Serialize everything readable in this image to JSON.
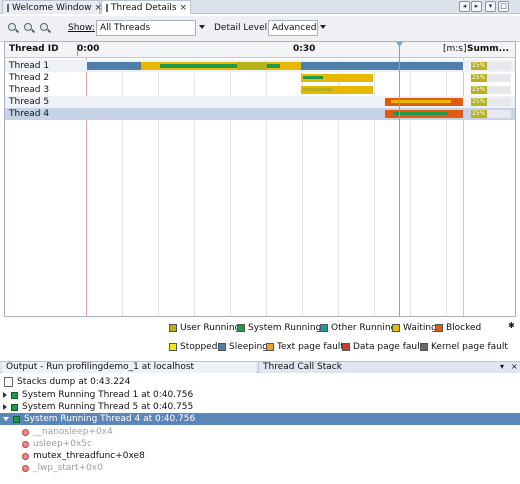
{
  "tabs": [
    {
      "label": "Welcome Window",
      "icon": "window-icon",
      "active": false
    },
    {
      "label": "Thread Details",
      "icon": "grid-icon",
      "active": true
    }
  ],
  "toolbar": {
    "show_label": "Show:",
    "show_value": "All Threads",
    "detail_label": "Detail Level:",
    "detail_value": "Advanced"
  },
  "timeline": {
    "col_thread": "Thread ID",
    "tick_0": "0:00",
    "tick_30": "0:30",
    "unit": "[m:s]",
    "col_summary": "Summ...",
    "threads": [
      {
        "name": "Thread 1",
        "summary_pct": "25%"
      },
      {
        "name": "Thread 2",
        "summary_pct": "25%"
      },
      {
        "name": "Thread 3",
        "summary_pct": "25%"
      },
      {
        "name": "Thread 5",
        "summary_pct": "25%"
      },
      {
        "name": "Thread 4",
        "summary_pct": "25%"
      }
    ]
  },
  "legend": [
    {
      "label": "User Running",
      "color": "#b8b21a"
    },
    {
      "label": "System Running",
      "color": "#1e9a4a"
    },
    {
      "label": "Other Running",
      "color": "#1a9a9a"
    },
    {
      "label": "Waiting",
      "color": "#e8b800"
    },
    {
      "label": "Blocked",
      "color": "#e05a10"
    },
    {
      "label": "Stopped",
      "color": "#f2e51a"
    },
    {
      "label": "Sleeping",
      "color": "#4f7faa"
    },
    {
      "label": "Text page fault",
      "color": "#f0a030"
    },
    {
      "label": "Data page fault",
      "color": "#d83a2a"
    },
    {
      "label": "Kernel page fault",
      "color": "#6a6a6a"
    }
  ],
  "output": {
    "tab_output": "Output - Run profilingdemo_1 at localhost",
    "tab_stack": "Thread Call Stack",
    "dump": "Stacks dump at 0:43.224",
    "entries": [
      "System Running Thread 1 at 0:40.756",
      "System Running Thread 5 at 0:40.755",
      "System Running Thread 4 at 0:40.756"
    ],
    "frames": [
      "__nanosleep+0x4",
      "usleep+0x5c",
      "mutex_threadfunc+0xe8",
      "_lwp_start+0x0"
    ]
  }
}
